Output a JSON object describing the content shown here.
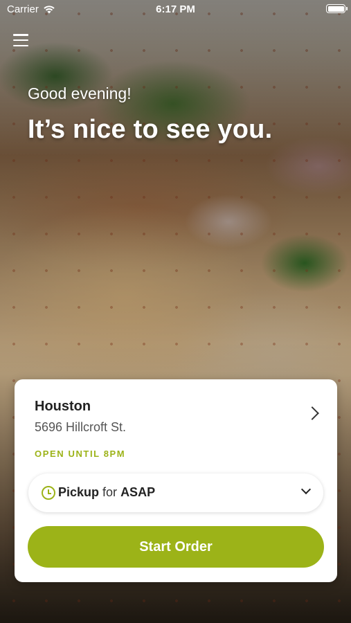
{
  "status_bar": {
    "carrier": "Carrier",
    "time": "6:17 PM",
    "icons": [
      "wifi-icon",
      "battery-icon"
    ]
  },
  "header": {
    "menu_icon": "hamburger-menu-icon"
  },
  "hero": {
    "greeting": "Good evening!",
    "headline": "It’s nice to see you."
  },
  "location": {
    "name": "Houston",
    "address": "5696 Hillcroft St.",
    "status": "OPEN UNTIL 8PM"
  },
  "order_time": {
    "mode": "Pickup",
    "connector": "for",
    "time": "ASAP",
    "icon": "clock-icon"
  },
  "actions": {
    "start_order": "Start Order"
  },
  "colors": {
    "accent": "#9cb318",
    "text_dark": "#222222",
    "card_bg": "#ffffff"
  }
}
